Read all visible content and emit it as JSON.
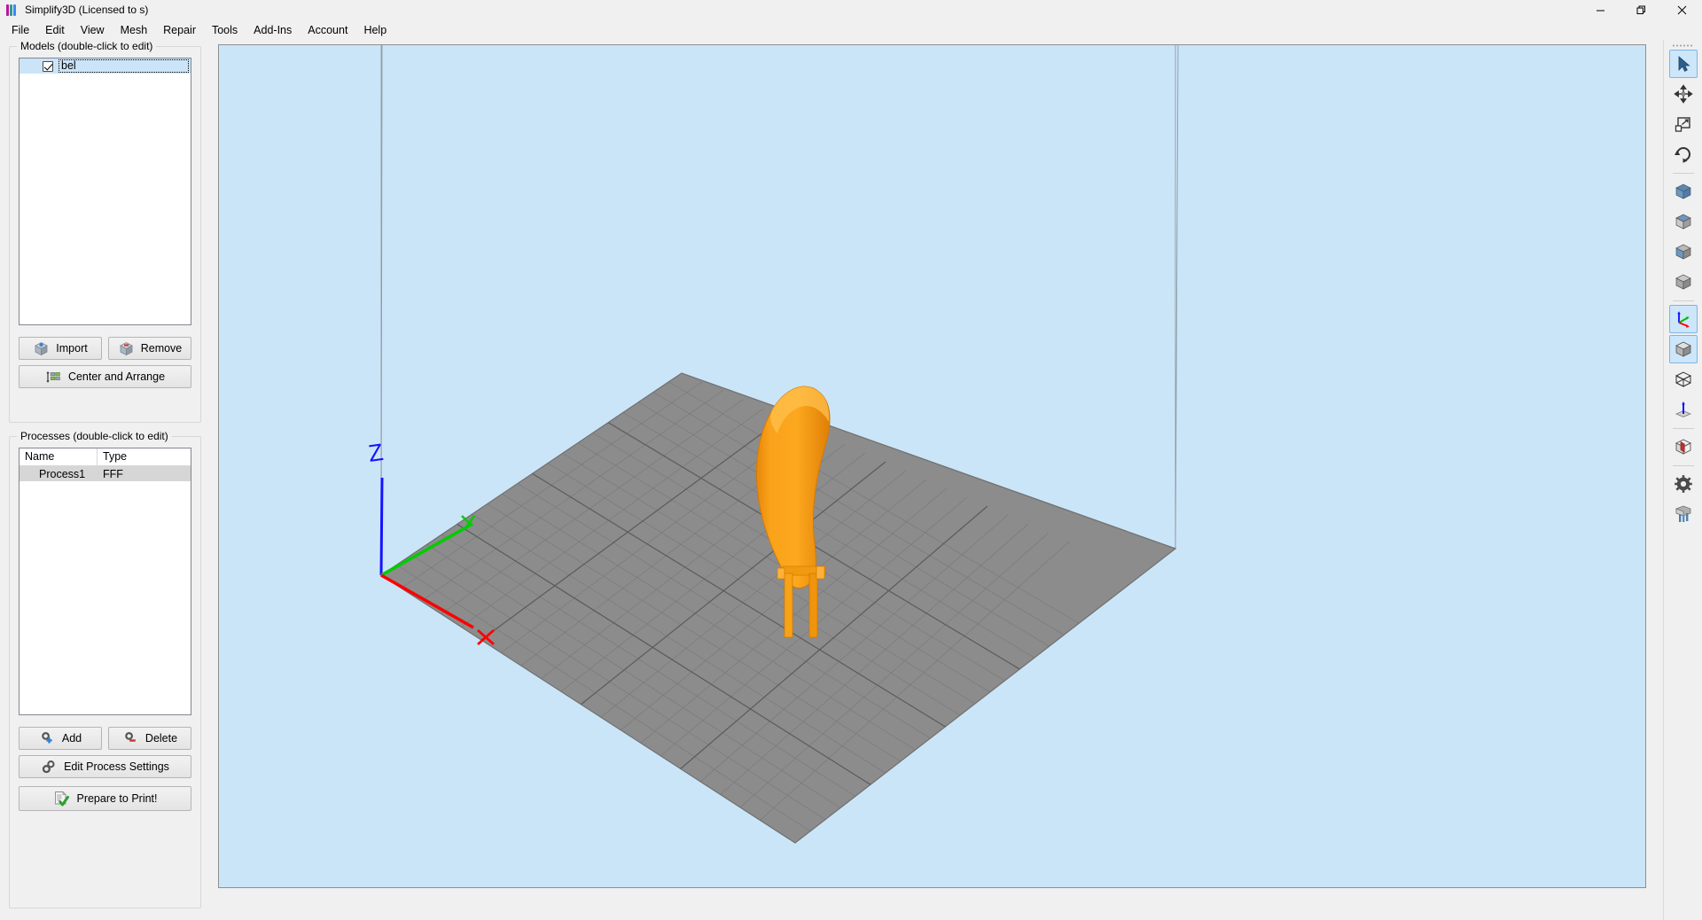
{
  "window": {
    "title": "Simplify3D (Licensed to s)",
    "logo_icon": "simplify3d-logo-icon",
    "controls": [
      {
        "name": "minimize-button",
        "icon": "minimize-icon"
      },
      {
        "name": "maximize-button",
        "icon": "restore-icon"
      },
      {
        "name": "close-button",
        "icon": "close-icon"
      }
    ]
  },
  "menubar": {
    "items": [
      {
        "label": "File"
      },
      {
        "label": "Edit"
      },
      {
        "label": "View"
      },
      {
        "label": "Mesh"
      },
      {
        "label": "Repair"
      },
      {
        "label": "Tools"
      },
      {
        "label": "Add-Ins"
      },
      {
        "label": "Account"
      },
      {
        "label": "Help"
      }
    ]
  },
  "models_panel": {
    "title": "Models (double-click to edit)",
    "items": [
      {
        "name": "bel",
        "checked": true,
        "selected": true,
        "editing": true
      }
    ],
    "buttons": {
      "import": {
        "label": "Import",
        "icon": "import-cube-icon"
      },
      "remove": {
        "label": "Remove",
        "icon": "remove-cube-icon"
      },
      "center_and_arrange": {
        "label": "Center and Arrange",
        "icon": "arrange-icon"
      }
    }
  },
  "processes_panel": {
    "title": "Processes (double-click to edit)",
    "columns": [
      "Name",
      "Type"
    ],
    "rows": [
      {
        "name": "Process1",
        "type": "FFF",
        "selected": true
      }
    ],
    "buttons": {
      "add": {
        "label": "Add",
        "icon": "add-gear-icon"
      },
      "delete": {
        "label": "Delete",
        "icon": "delete-gear-icon"
      },
      "edit_process_settings": {
        "label": "Edit Process Settings",
        "icon": "gears-icon"
      },
      "prepare_to_print": {
        "label": "Prepare to Print!",
        "icon": "prepare-check-icon"
      }
    }
  },
  "viewport": {
    "background_color": "#cbe5f8",
    "build_plate_color": "#8c8c8c",
    "model_color": "#f5a012",
    "axes": [
      {
        "label": "Z",
        "color": "#1414ff"
      },
      {
        "label": "Y",
        "color": "#00d000"
      },
      {
        "label": "X",
        "color": "#ff0000"
      }
    ]
  },
  "toolbar": {
    "grip_icon": "drag-grip-icon",
    "tools": [
      {
        "name": "select-tool",
        "icon": "cursor-arrow-icon",
        "active": true
      },
      {
        "name": "move-tool",
        "icon": "move-arrows-icon",
        "active": false
      },
      {
        "name": "scale-tool",
        "icon": "scale-icon",
        "active": false
      },
      {
        "name": "rotate-tool",
        "icon": "rotate-icon",
        "active": false
      },
      {
        "name": "view-isometric",
        "icon": "cube-blue-top-icon",
        "active": false
      },
      {
        "name": "view-front",
        "icon": "cube-gray-front-icon",
        "active": false
      },
      {
        "name": "view-side",
        "icon": "cube-blue-side-icon",
        "active": false
      },
      {
        "name": "view-back",
        "icon": "cube-gray-back-icon",
        "active": false
      },
      {
        "name": "toggle-axes",
        "icon": "axes-icon",
        "active": true
      },
      {
        "name": "shading-solid",
        "icon": "solid-cube-icon",
        "active": true
      },
      {
        "name": "shading-wireframe",
        "icon": "wireframe-cube-icon",
        "active": false
      },
      {
        "name": "toggle-bed",
        "icon": "bed-normal-icon",
        "active": false
      },
      {
        "name": "cross-section",
        "icon": "cross-section-cube-icon",
        "active": false
      },
      {
        "name": "settings",
        "icon": "gear-icon",
        "active": false
      },
      {
        "name": "supports",
        "icon": "supports-icon",
        "active": false
      }
    ]
  }
}
